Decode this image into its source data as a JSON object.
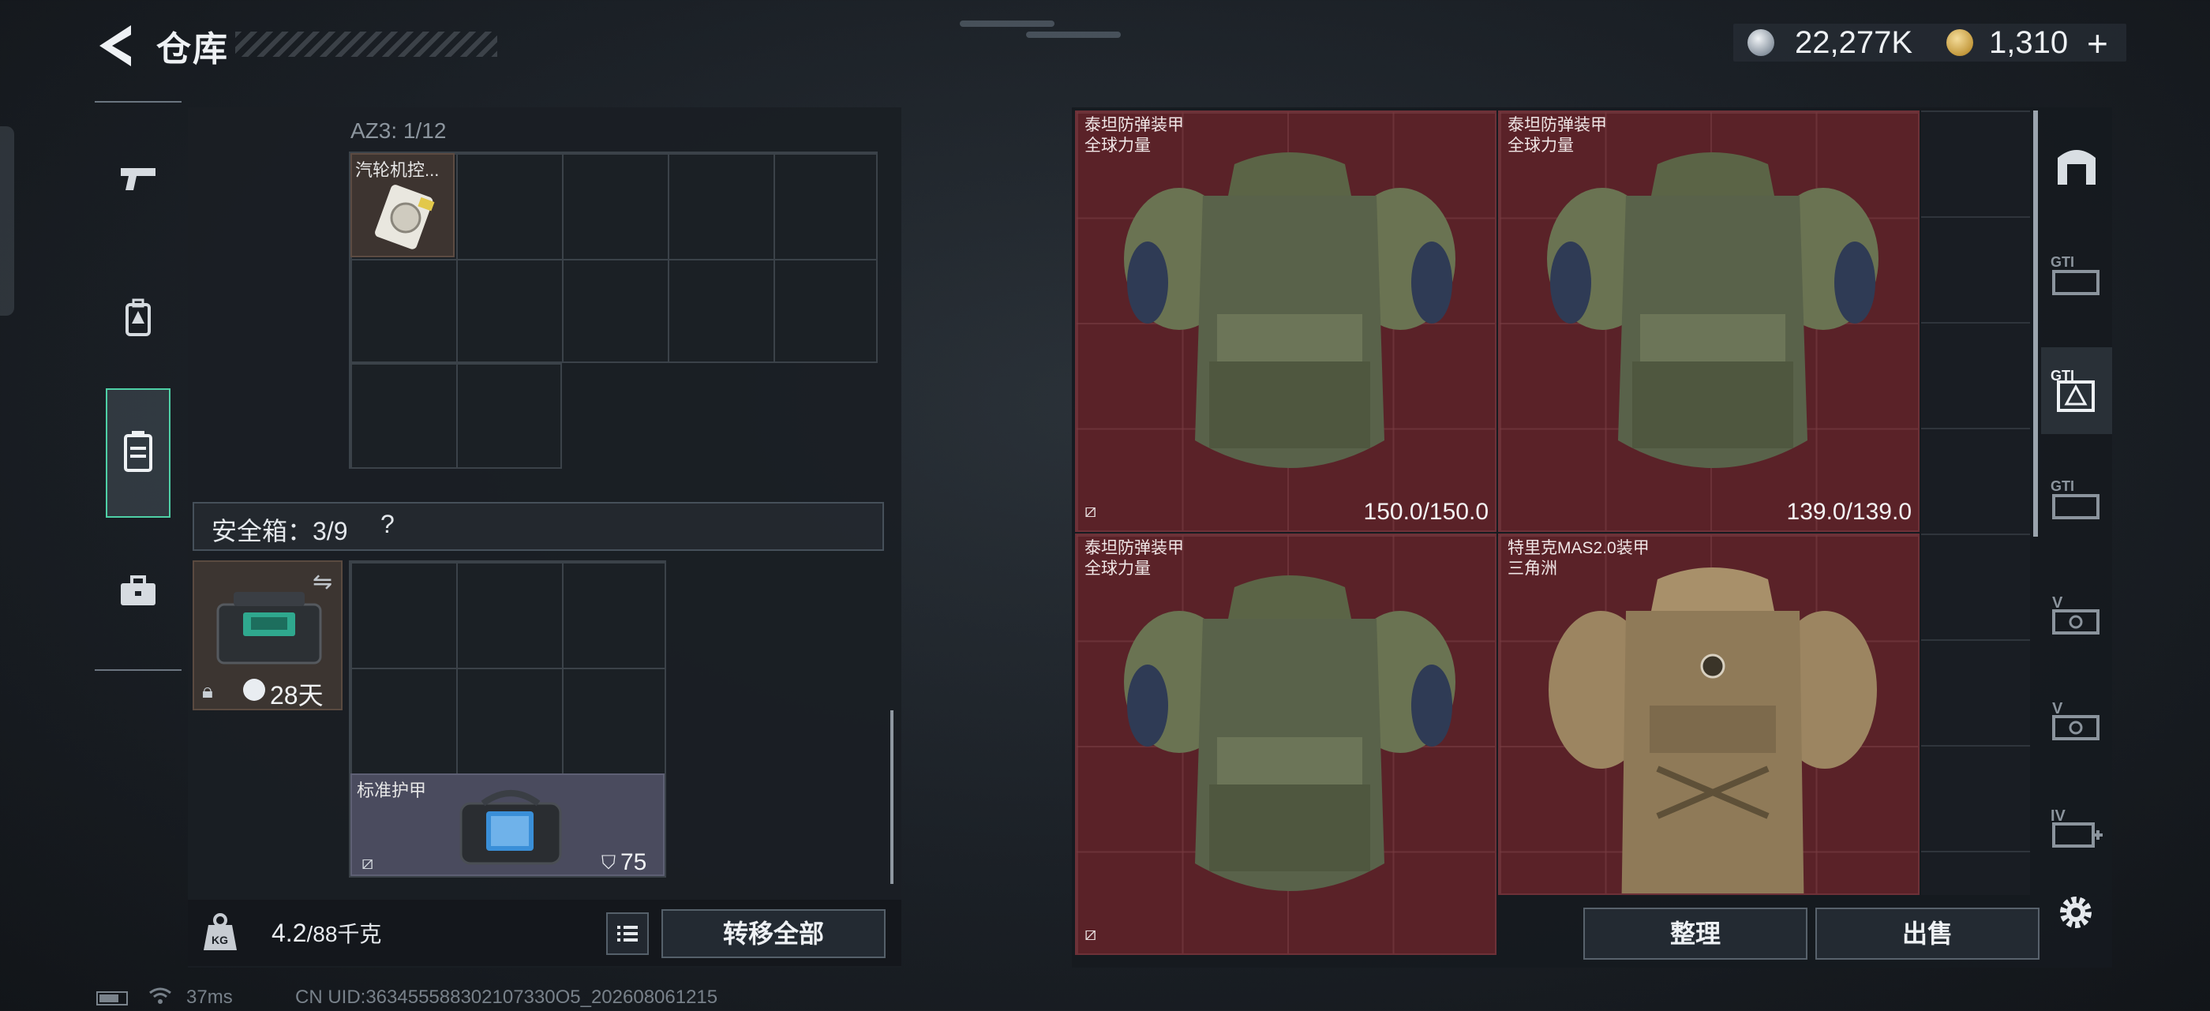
{
  "header": {
    "title": "仓库",
    "currency": {
      "silver": "22,277K",
      "gold": "1,310",
      "plus_label": "+"
    }
  },
  "left_nav": {
    "items": [
      {
        "name": "weapons",
        "icon": "pistol-icon"
      },
      {
        "name": "equipment",
        "icon": "backpack-icon"
      },
      {
        "name": "containers",
        "icon": "container-icon",
        "active": true
      },
      {
        "name": "items",
        "icon": "briefcase-icon"
      }
    ]
  },
  "backpack": {
    "az3_label": "AZ3: 1/12",
    "items": [
      {
        "name": "汽轮机控..."
      }
    ],
    "safebox": {
      "label": "安全箱：3/9",
      "help": "?",
      "days": "28天",
      "items": [
        {
          "name": "标准护甲",
          "durability": "75"
        }
      ]
    },
    "weight": {
      "current": "4.2",
      "max": "/88千克"
    },
    "transfer_all": "转移全部"
  },
  "storage": {
    "slots": [
      {
        "name": "泰坦防弹装甲\n全球力量",
        "durability": "150.0/150.0"
      },
      {
        "name": "泰坦防弹装甲\n全球力量",
        "durability": "139.0/139.0"
      },
      {
        "name": "泰坦防弹装甲\n全球力量",
        "durability": ""
      },
      {
        "name": "特里克MAS2.0装甲\n三角洲",
        "durability": ""
      }
    ],
    "sort_label": "整理",
    "sell_label": "出售"
  },
  "right_nav": {
    "items": [
      {
        "label": "",
        "icon": "door-icon"
      },
      {
        "label": "GTI",
        "icon": "storage-gti-1-icon"
      },
      {
        "label": "GTI",
        "icon": "storage-gti-2-icon",
        "active": true
      },
      {
        "label": "GTI",
        "icon": "storage-gti-3-icon"
      },
      {
        "label": "V",
        "icon": "storage-v-1-icon"
      },
      {
        "label": "V",
        "icon": "storage-v-2-icon"
      },
      {
        "label": "IV",
        "icon": "storage-iv-icon"
      }
    ]
  },
  "status_bar": {
    "ping": "37ms",
    "uid": "CN UID:363455588302107330O5_202608061215"
  },
  "colors": {
    "accent": "#4ed0a6",
    "storage_slot_bg": "#5a2228",
    "panel_bg": "#1a1e24"
  }
}
